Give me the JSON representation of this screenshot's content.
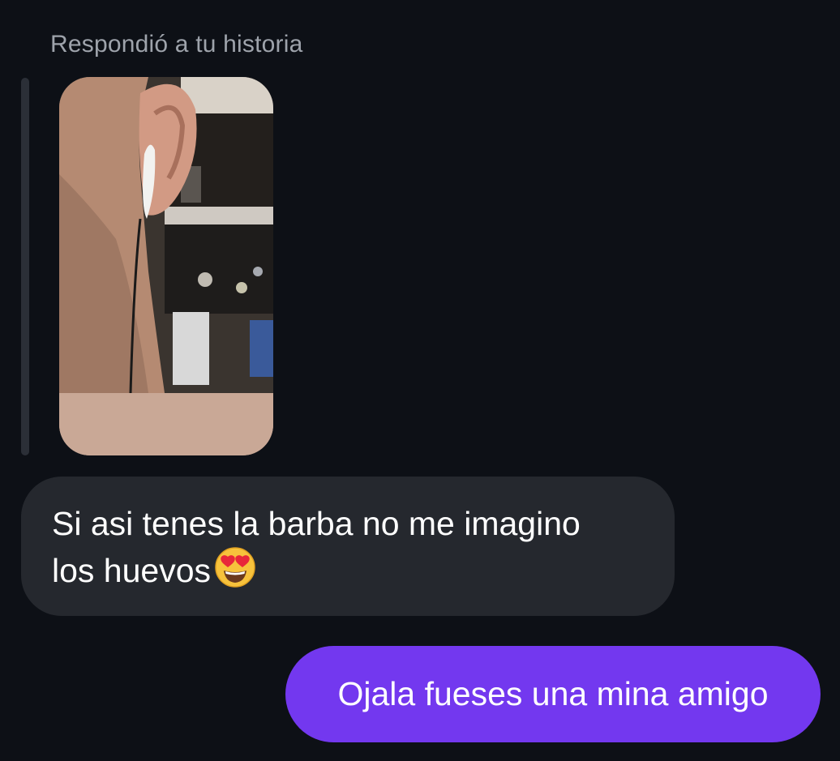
{
  "story_reply": {
    "caption": "Respondió a tu historia"
  },
  "messages": {
    "received": {
      "line1": "Si asi tenes la barba no me imagino",
      "line2": "los huevos",
      "emoji_icon": "heart-eyes-emoji"
    },
    "sent": {
      "text": "Ojala fueses una mina amigo"
    }
  },
  "colors": {
    "background": "#0d1016",
    "received_bubble": "#25282e",
    "sent_bubble": "#7338ef",
    "caption_text": "#9ea3ab"
  }
}
